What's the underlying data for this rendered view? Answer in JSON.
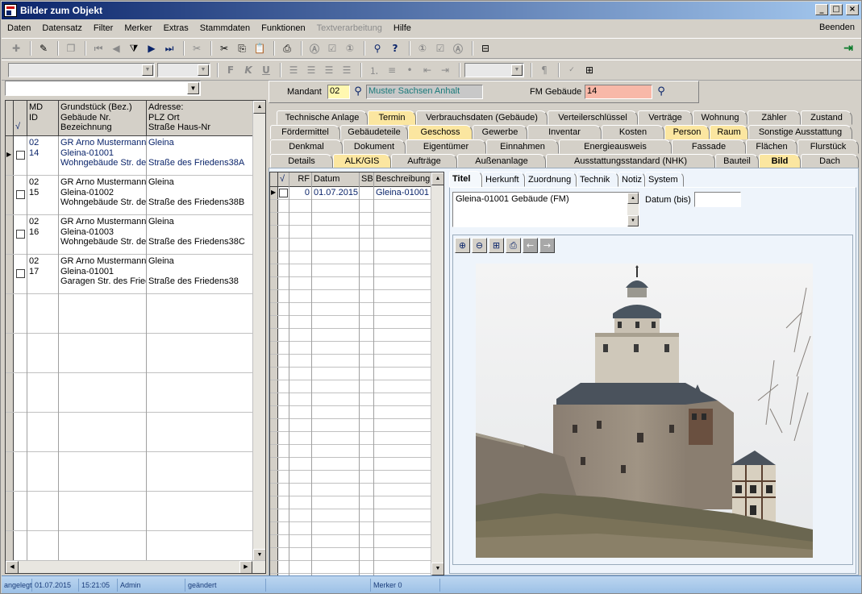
{
  "window": {
    "title": "Bilder zum Objekt"
  },
  "menu": {
    "items": [
      "Daten",
      "Datensatz",
      "Filter",
      "Merker",
      "Extras",
      "Stammdaten",
      "Funktionen",
      "Textverarbeitung",
      "Hilfe"
    ],
    "disabled": [
      "Textverarbeitung"
    ],
    "beenden": "Beenden"
  },
  "toolbar2": {
    "font_bold": "F",
    "font_italic": "K",
    "font_underline": "U",
    "pilcrow": "¶"
  },
  "left_grid": {
    "headers": {
      "check": "√",
      "md_id": [
        "MD",
        "ID"
      ],
      "grundstueck": [
        "Grundstück (Bez.)",
        "Gebäude Nr.",
        "Bezeichnung"
      ],
      "adresse": [
        "Adresse:",
        "PLZ Ort",
        "Straße Haus-Nr"
      ]
    },
    "rows": [
      {
        "md": "02",
        "id": "14",
        "g1": "GR Arno Mustermann",
        "g2": "Gleina-01001",
        "g3": "Wohngebäude Str. de",
        "a1": "Gleina",
        "a2": "",
        "a3": "Straße des Friedens38A"
      },
      {
        "md": "02",
        "id": "15",
        "g1": "GR Arno Mustermann",
        "g2": "Gleina-01002",
        "g3": "Wohngebäude Str. de",
        "a1": "Gleina",
        "a2": "",
        "a3": "Straße des Friedens38B"
      },
      {
        "md": "02",
        "id": "16",
        "g1": "GR Arno Mustermann",
        "g2": "Gleina-01003",
        "g3": "Wohngebäude Str. de",
        "a1": "Gleina",
        "a2": "",
        "a3": "Straße des Friedens38C"
      },
      {
        "md": "02",
        "id": "17",
        "g1": "GR Arno Mustermann",
        "g2": "Gleina-01001",
        "g3": "Garagen Str. des Fried",
        "a1": "Gleina",
        "a2": "",
        "a3": "Straße des Friedens38"
      }
    ]
  },
  "mandant": {
    "label": "Mandant",
    "code": "02",
    "name": "Muster Sachsen Anhalt",
    "fm_label": "FM Gebäude",
    "fm_value": "14"
  },
  "tabs": {
    "row1": [
      "Technische Anlage",
      "Termin",
      "Verbrauchsdaten (Gebäude)",
      "Verteilerschlüssel",
      "Verträge",
      "Wohnung",
      "Zähler",
      "Zustand"
    ],
    "row2": [
      "Fördermittel",
      "Gebäudeteile",
      "Geschoss",
      "Gewerbe",
      "Inventar",
      "Kosten",
      "Person",
      "Raum",
      "Sonstige Ausstattung"
    ],
    "row3": [
      "Denkmal",
      "Dokument",
      "Eigentümer",
      "Einnahmen",
      "Energieausweis",
      "Fassade",
      "Flächen",
      "Flurstück"
    ],
    "row4": [
      "Details",
      "ALK/GIS",
      "Aufträge",
      "Außenanlage",
      "Ausstattungsstandard (NHK)",
      "Bauteil",
      "Bild",
      "Dach"
    ]
  },
  "image_grid": {
    "headers": {
      "check": "√",
      "rf": "RF",
      "datum": "Datum",
      "sb": "SB",
      "beschreibung": "Beschreibung"
    },
    "rows": [
      {
        "rf": "0",
        "datum": "01.07.2015",
        "sb": "",
        "beschreibung": "Gleina-01001"
      }
    ]
  },
  "subtabs": [
    "Titel",
    "Herkunft",
    "Zuordnung",
    "Technik",
    "Notiz",
    "System"
  ],
  "detail": {
    "title_text": "Gleina-01001  Gebäude (FM)",
    "datum_label": "Datum (bis)",
    "datum_value": ""
  },
  "status": {
    "angelegt": "angelegt",
    "date": "01.07.2015",
    "time": "15:21:05",
    "user": "Admin",
    "geaendert": "geändert",
    "merker_label": "Merker",
    "merker_value": "0"
  },
  "colors": {
    "titlebar_start": "#0a246a",
    "titlebar_end": "#a6caf0",
    "tab_highlight": "#fbe6a0",
    "mandant_code_bg": "#fff8b0",
    "fm_value_bg": "#f8b8a8",
    "grid_text": "#0a246a",
    "panel_bg": "#eef4fb"
  }
}
